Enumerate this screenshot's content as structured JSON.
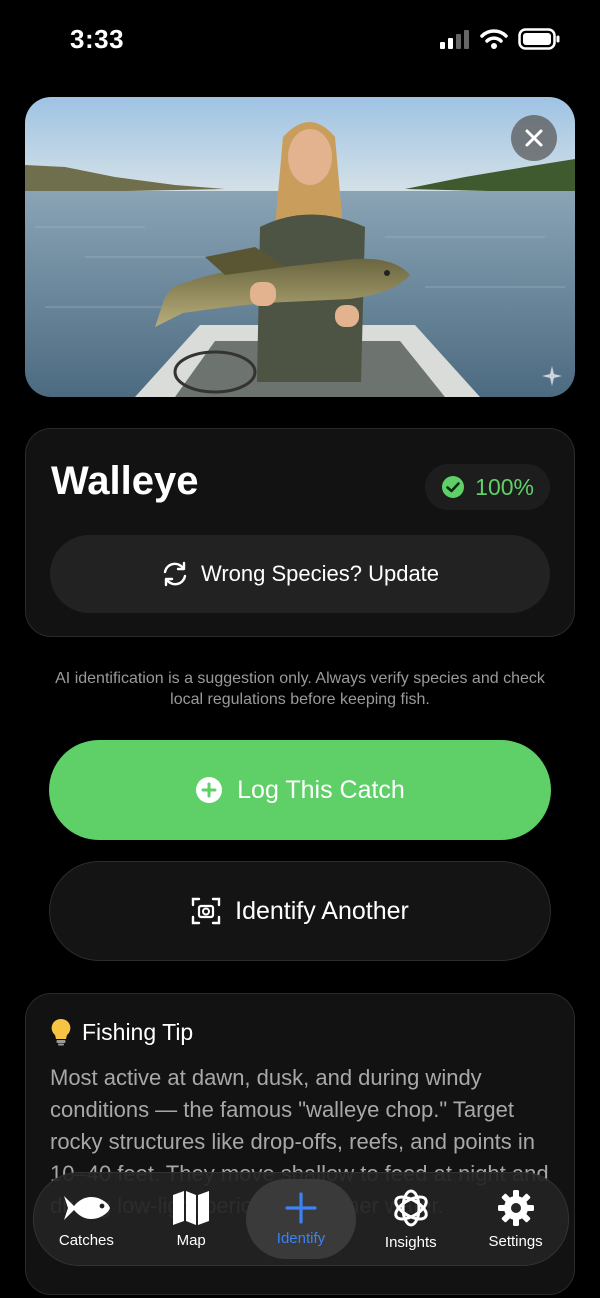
{
  "status": {
    "time": "3:33"
  },
  "result": {
    "species": "Walleye",
    "confidence": "100%",
    "wrong_species_label": "Wrong Species? Update"
  },
  "disclaimer": "AI identification is a suggestion only. Always verify species and check local regulations before keeping fish.",
  "actions": {
    "log_label": "Log This Catch",
    "identify_label": "Identify Another"
  },
  "tip": {
    "title": "Fishing Tip",
    "body": "Most active at dawn, dusk, and during windy conditions — the famous \"walleye chop.\" Target rocky structures like drop-offs, reefs, and points in 10–40 feet. They move shallow to feed at night and during low-light periods in warmer water."
  },
  "tabs": [
    {
      "label": "Catches",
      "icon": "fish-icon"
    },
    {
      "label": "Map",
      "icon": "map-icon"
    },
    {
      "label": "Identify",
      "icon": "plus-icon"
    },
    {
      "label": "Insights",
      "icon": "insights-icon"
    },
    {
      "label": "Settings",
      "icon": "gear-icon"
    }
  ],
  "colors": {
    "accent_green": "#5fd068",
    "active_blue": "#3b82f6",
    "background": "#000000"
  }
}
